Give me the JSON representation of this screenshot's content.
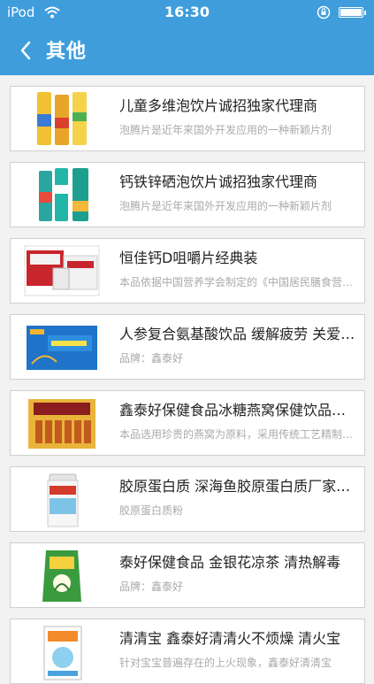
{
  "status_bar": {
    "carrier": "iPod",
    "time": "16:30"
  },
  "nav": {
    "title": "其他",
    "back_icon": "chevron-left-icon"
  },
  "colors": {
    "primary": "#3f9ddc",
    "background": "#f2f2f2"
  },
  "items": [
    {
      "title": "儿童多维泡饮片诚招独家代理商",
      "desc": "泡腾片是近年来国外开发应用的一种新颖片剂",
      "image": "vitamin-tube-pack"
    },
    {
      "title": "钙铁锌硒泡饮片诚招独家代理商",
      "desc": "泡腾片是近年来国外开发应用的一种新颖片剂",
      "image": "mineral-tube-pack"
    },
    {
      "title": "恒佳钙D咀嚼片经典装",
      "desc": "本品依据中国营养学会制定的《中国居民膳食营养素参考摄入量》",
      "image": "calcium-boxes"
    },
    {
      "title": "人参复合氨基酸饮品 缓解疲劳 关爱健康",
      "desc": "品牌：鑫泰好",
      "image": "ginseng-box"
    },
    {
      "title": "鑫泰好保健食品冰糖燕窝保健饮品礼盒装",
      "desc": "本品选用珍贵的燕窝为原料，采用传统工艺精制而成",
      "image": "birdnest-giftbox"
    },
    {
      "title": "胶原蛋白质 深海鱼胶原蛋白质厂家直销",
      "desc": "胶原蛋白质粉",
      "image": "collagen-can"
    },
    {
      "title": "泰好保健食品 金银花凉茶 清热解毒",
      "desc": "品牌：鑫泰好",
      "image": "herbal-tea-bag"
    },
    {
      "title": "清清宝 鑫泰好清清火不烦燥 清火宝",
      "desc": "针对宝宝普遍存在的上火现象，鑫泰好清清宝",
      "image": "baby-product-box"
    }
  ]
}
